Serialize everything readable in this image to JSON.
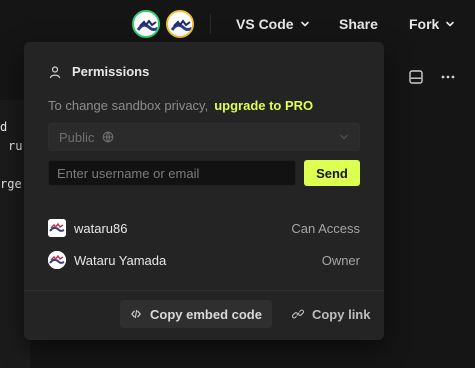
{
  "topbar": {
    "avatars": [
      {
        "name": "avatar-1"
      },
      {
        "name": "avatar-2"
      }
    ],
    "vs_code_label": "VS Code",
    "share_label": "Share",
    "fork_label": "Fork"
  },
  "background": {
    "code_lines": [
      "d",
      "ru",
      "rge"
    ]
  },
  "permissions": {
    "title": "Permissions",
    "privacy_text": "To change sandbox privacy,",
    "upgrade_text": "upgrade to PRO",
    "privacy_select_value": "Public",
    "invite_placeholder": "Enter username or email",
    "send_label": "Send",
    "users": [
      {
        "name": "wataru86",
        "role": "Can Access"
      },
      {
        "name": "Wataru Yamada",
        "role": "Owner"
      }
    ],
    "copy_embed_label": "Copy embed code",
    "copy_link_label": "Copy link"
  },
  "colors": {
    "accent": "#dcff50",
    "bg": "#151515",
    "panel": "#242424"
  }
}
